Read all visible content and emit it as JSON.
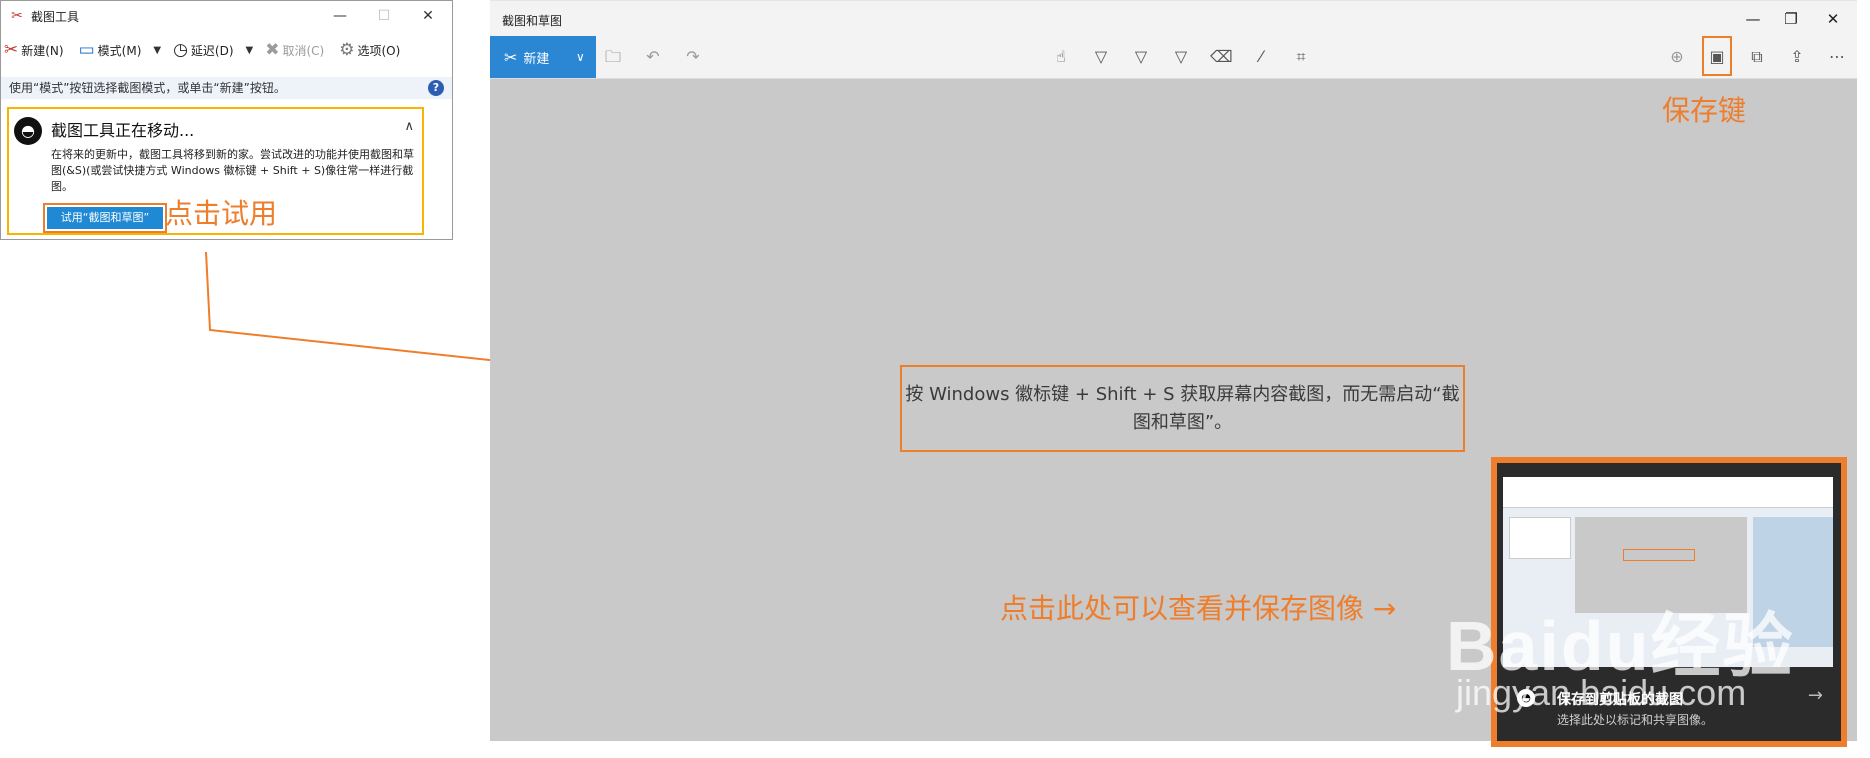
{
  "snipping_tool": {
    "title": "截图工具",
    "window_buttons": {
      "minimize": "—",
      "maximize": "☐",
      "close": "✕"
    },
    "toolbar": {
      "new_label": "新建(N)",
      "mode_label": "模式(M)",
      "delay_label": "延迟(D)",
      "cancel_label": "取消(C)",
      "options_label": "选项(O)"
    },
    "info_text": "使用“模式”按钮选择截图模式，或单击“新建”按钮。",
    "help_label": "?",
    "notice": {
      "title": "截图工具正在移动...",
      "body": "在将来的更新中，截图工具将移到新的家。尝试改进的功能并使用截图和草图(&S)(或尝试快捷方式 Windows 徽标键 + Shift + S)像往常一样进行截图。",
      "try_button_label": "试用“截图和草图”"
    }
  },
  "snip_sketch": {
    "title": "截图和草图",
    "new_label": "新建",
    "center_message": "按 Windows 徽标键 + Shift + S 获取屏幕内容截图，而无需启动“截图和草图”。",
    "notification": {
      "title": "保存到剪贴板的截图",
      "subtitle": "选择此处以标记和共享图像。"
    }
  },
  "annotations": {
    "click_try": "点击试用",
    "save_key": "保存键",
    "click_here": "点击此处可以查看并保存图像 →"
  },
  "watermark": {
    "brand": "Baidu经验",
    "url": "jingyan.baidu.com"
  },
  "colors": {
    "accent_orange": "#ee7d2c",
    "new_button_blue": "#2b86d4",
    "notice_border": "#f7b500",
    "canvas_gray": "#c9c9c9"
  },
  "icons": [
    "scissors-icon",
    "mode-rect-icon",
    "clock-icon",
    "cancel-x-icon",
    "gear-icon",
    "help-icon",
    "snip-sketch-icon",
    "folder-icon",
    "undo-icon",
    "redo-icon",
    "touch-writing-icon",
    "ballpoint-pen-icon",
    "pencil-icon",
    "highlighter-icon",
    "eraser-icon",
    "ruler-icon",
    "crop-icon",
    "zoom-icon",
    "save-icon",
    "copy-icon",
    "share-icon",
    "more-icon"
  ]
}
